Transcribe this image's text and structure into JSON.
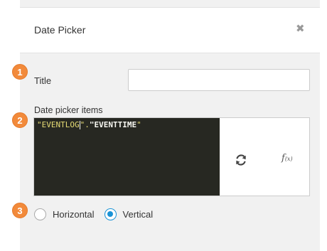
{
  "dialog": {
    "title": "Date Picker",
    "close_glyph": "✖"
  },
  "steps": [
    "1",
    "2",
    "3"
  ],
  "title_field": {
    "label": "Title",
    "value": "",
    "placeholder": ""
  },
  "date_picker_items": {
    "label": "Date picker items",
    "code": {
      "q1": "\"EVENTLOG",
      "q2": "\".",
      "q3": "\"EVENTTIME",
      "q4": "\""
    },
    "refresh_icon": "refresh-icon",
    "fx_label": "f(x)"
  },
  "orientation": {
    "options": [
      {
        "label": "Horizontal",
        "selected": false
      },
      {
        "label": "Vertical",
        "selected": true
      }
    ]
  },
  "colors": {
    "accent": "#1a93d6",
    "badge": "#f28a3b",
    "editor_bg": "#272822",
    "string_yellow": "#e6db74"
  }
}
